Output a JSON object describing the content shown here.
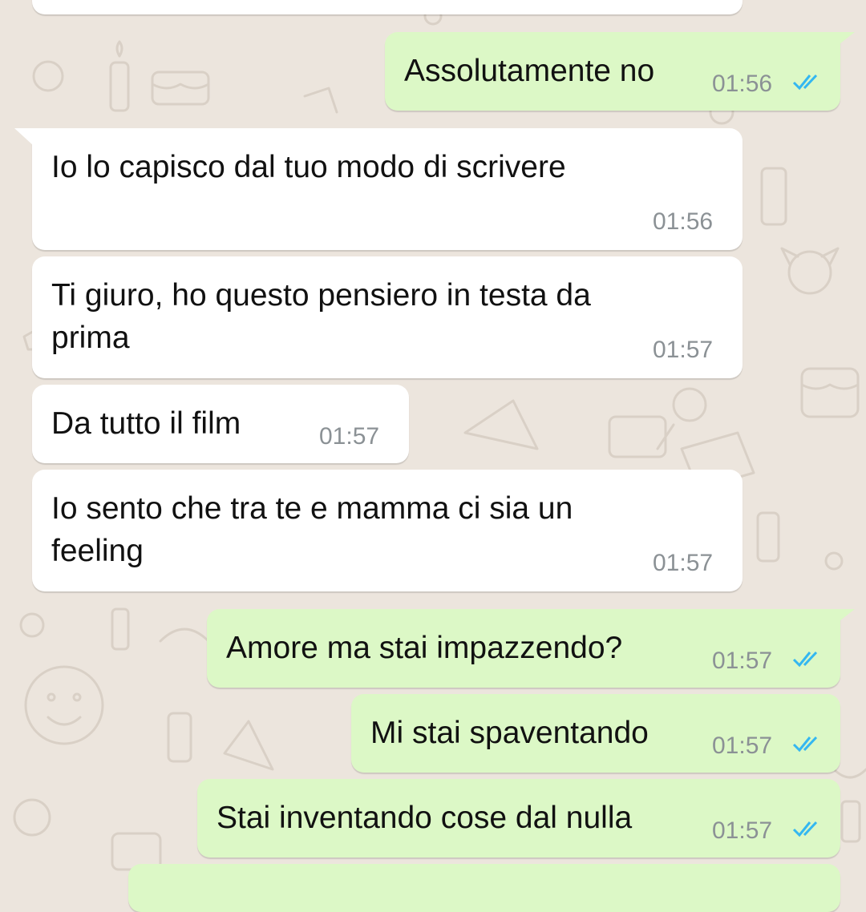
{
  "colors": {
    "background": "#ece5dd",
    "incoming_bubble": "#ffffff",
    "outgoing_bubble": "#dcf8c6",
    "timestamp": "#8b9195",
    "read_ticks": "#34b7f1"
  },
  "messages": [
    {
      "direction": "outgoing",
      "text": "Assolutamente no",
      "time": "01:56",
      "status_icon": "double-check-read-icon"
    },
    {
      "direction": "incoming",
      "text": "Io lo capisco dal tuo modo di scrivere",
      "time": "01:56"
    },
    {
      "direction": "incoming",
      "text_line1": "Ti giuro, ho questo pensiero in testa da",
      "text_line2": "prima",
      "time": "01:57"
    },
    {
      "direction": "incoming",
      "text": "Da tutto il film",
      "time": "01:57"
    },
    {
      "direction": "incoming",
      "text_line1": "Io sento che tra te e mamma ci sia un",
      "text_line2": "feeling",
      "time": "01:57"
    },
    {
      "direction": "outgoing",
      "text": "Amore ma stai impazzendo?",
      "time": "01:57",
      "status_icon": "double-check-read-icon"
    },
    {
      "direction": "outgoing",
      "text": "Mi stai spaventando",
      "time": "01:57",
      "status_icon": "double-check-read-icon"
    },
    {
      "direction": "outgoing",
      "text": "Stai inventando cose dal nulla",
      "time": "01:57",
      "status_icon": "double-check-read-icon"
    }
  ]
}
